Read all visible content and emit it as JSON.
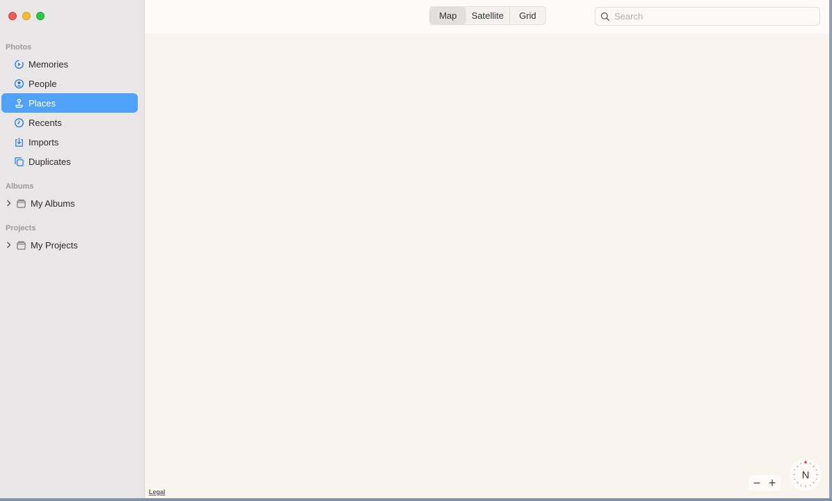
{
  "sidebar": {
    "sections": {
      "photos": "Photos",
      "albums": "Albums",
      "projects": "Projects"
    },
    "items": [
      {
        "label": "Memories",
        "icon": "memories-icon"
      },
      {
        "label": "People",
        "icon": "people-icon"
      },
      {
        "label": "Places",
        "icon": "places-icon",
        "selected": true
      },
      {
        "label": "Recents",
        "icon": "recents-icon"
      },
      {
        "label": "Imports",
        "icon": "imports-icon"
      },
      {
        "label": "Duplicates",
        "icon": "duplicates-icon"
      }
    ],
    "groups": [
      {
        "label": "My Albums",
        "icon": "folder-icon"
      },
      {
        "label": "My Projects",
        "icon": "folder-icon"
      }
    ]
  },
  "toolbar": {
    "view_modes": [
      "Map",
      "Satellite",
      "Grid"
    ],
    "active_mode": "Map",
    "search_placeholder": "Search"
  },
  "map": {
    "legal": "Legal",
    "zoom_out": "−",
    "zoom_in": "+",
    "compass_label": "N"
  },
  "colors": {
    "accent": "#4fa2f7",
    "sidebar_bg": "#e8e6e6",
    "map_bg": "#f9f4ee",
    "compass_north": "#e8423c"
  }
}
